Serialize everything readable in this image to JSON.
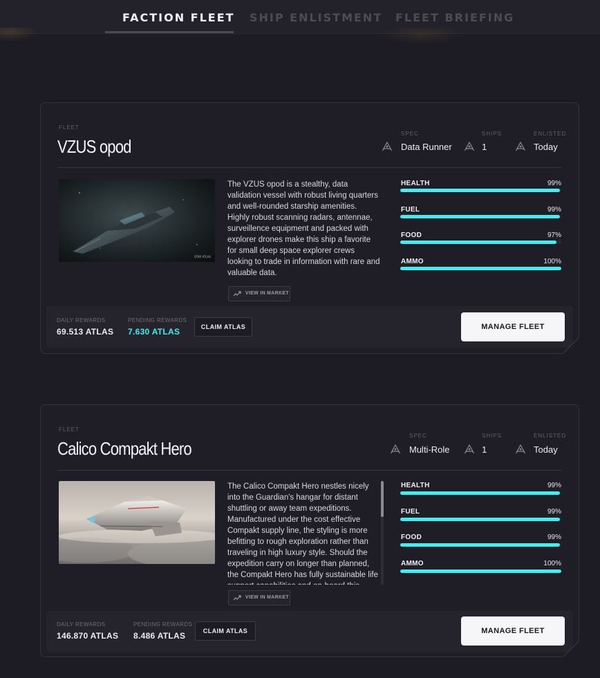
{
  "tabs": [
    {
      "label": "FACTION FLEET",
      "active": true
    },
    {
      "label": "SHIP ENLISTMENT",
      "active": false
    },
    {
      "label": "FLEET BRIEFING",
      "active": false
    }
  ],
  "labels": {
    "fleet": "FLEET",
    "spec": "SPEC",
    "ships": "SHIPS",
    "enlisted": "ENLISTED",
    "view_market": "VIEW IN MARKET",
    "daily_rewards": "DAILY REWARDS",
    "pending_rewards": "PENDING REWARDS",
    "claim": "CLAIM ATLAS",
    "manage": "MANAGE FLEET"
  },
  "colors": {
    "accent": "#41eef2",
    "background": "#1d1c25",
    "card": "#1f1e27"
  },
  "fleets": [
    {
      "name": "VZUS opod",
      "spec": "Data Runner",
      "ships": "1",
      "enlisted": "Today",
      "image_caption": "STAR ATLAS",
      "description": "The VZUS opod is a stealthy, data validation vessel with robust living quarters and well-rounded starship amenities. Highly robust scanning radars, antennae, surveillence equipment and packed with explorer drones make this ship a favorite for small deep space explorer crews looking to trade in information with rare and valuable data.",
      "stats": [
        {
          "name": "HEALTH",
          "pct": "99%",
          "value": 99
        },
        {
          "name": "FUEL",
          "pct": "99%",
          "value": 99
        },
        {
          "name": "FOOD",
          "pct": "97%",
          "value": 97
        },
        {
          "name": "AMMO",
          "pct": "100%",
          "value": 100
        }
      ],
      "daily_rewards": "69.513 ATLAS",
      "pending_rewards": "7.630 ATLAS"
    },
    {
      "name": "Calico Compakt Hero",
      "spec": "Multi-Role",
      "ships": "1",
      "enlisted": "Today",
      "description": "The Calico Compakt Hero nestles nicely into the Guardian's hangar for distant shuttling or away team expeditions. Manufactured under the cost effective Compakt supply line, the styling is more befitting to rough exploration rather than traveling in high luxury style. Should the expedition carry on longer than planned, the Compakt Hero has fully sustainable life support capabilities and on-board this",
      "stats": [
        {
          "name": "HEALTH",
          "pct": "99%",
          "value": 99
        },
        {
          "name": "FUEL",
          "pct": "99%",
          "value": 99
        },
        {
          "name": "FOOD",
          "pct": "99%",
          "value": 99
        },
        {
          "name": "AMMO",
          "pct": "100%",
          "value": 100
        }
      ],
      "daily_rewards": "146.870 ATLAS",
      "pending_rewards": "8.486 ATLAS"
    }
  ]
}
